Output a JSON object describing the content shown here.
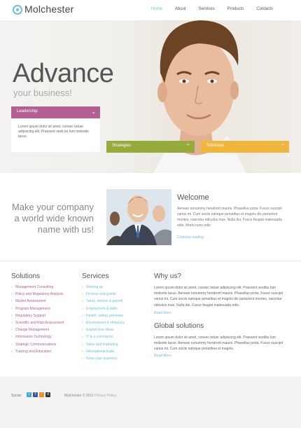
{
  "header": {
    "logo_text": "Molchester",
    "nav": [
      "Home",
      "About",
      "Services",
      "Products",
      "Contacts"
    ]
  },
  "hero": {
    "title": "Advance",
    "subtitle": "your business!",
    "leadership": {
      "label": "Leadership",
      "text": "Lorem ipsum dolor sit amet, consec tetuer adipiscing elit. Praesent vesti bu lum molestie lacus."
    },
    "strategies_label": "Strategies",
    "solutions_label": "Solutions"
  },
  "welcome": {
    "slogan": "Make your company a world wide known name with us!",
    "title": "Welcome",
    "text": "Aenean nonummy hendrerit mauris. Phasellus porta. Fusce suscipit varius mi. Cum sociis natoque penatibus et magnis dis parturient montes, nascetur ridiculus mus. Nulla dui. Fusce feugiat malesuada odio. Morbi nunc odio",
    "link": "Continue reading"
  },
  "solutions": {
    "title": "Solutions",
    "items": [
      "Management Consulting",
      "Policy and Regulatory Analysis",
      "Market Assessment",
      "Program Management",
      "Regulatory Support",
      "Scientific and Risk Assessment",
      "Change Management",
      "Information Technology",
      "Strategic Communications",
      "Training and Education"
    ]
  },
  "services": {
    "title": "Services",
    "items": [
      "Starting up",
      "Finance and grants",
      "Taxes, returns & payroll",
      "Employment & skills",
      "Health, safety, premises",
      "Environment & efficiency",
      "Exploit your ideas",
      "IT & e-commerce",
      "Sales and marketing",
      "International trade",
      "Grow your business"
    ]
  },
  "why": {
    "title": "Why us?",
    "text": "Lorem ipsum dolor sit amet, consec tetuer adipiscing elit. Praesent vestibu lum molestie lacus. Aenean nonummy hendrerit mauris. Phasellus porta. Fusce suscipit varius mi. Cum sociis natoque penatibus et magnis dis parturient montes, nascetur ridiculus mus. Nulla dui. Fusce feugiat malesuada odio.",
    "link": "Read More"
  },
  "global": {
    "title": "Global solutions",
    "text": "Lorem ipsum dolor sit amet, consec tetuer adipiscing elit. Praesent vestibu lum molestie lacus. Aenean nonummy hendrerit mauris. Phasellus porta. Fusce suscipit varius mi. Cum sociis natoque penatibus et magnis.",
    "link": "Read More"
  },
  "footer": {
    "social_label": "Social:",
    "copyright": "Molchester © 2011",
    "privacy": "Privacy Policy"
  },
  "colors": {
    "accent_blue": "#6cc0de",
    "leadership": "#b55d95",
    "strategies": "#97aa3c",
    "solutions": "#f0b63c"
  },
  "icons": [
    "twitter-icon",
    "facebook-icon",
    "rss-icon",
    "delicious-icon"
  ]
}
